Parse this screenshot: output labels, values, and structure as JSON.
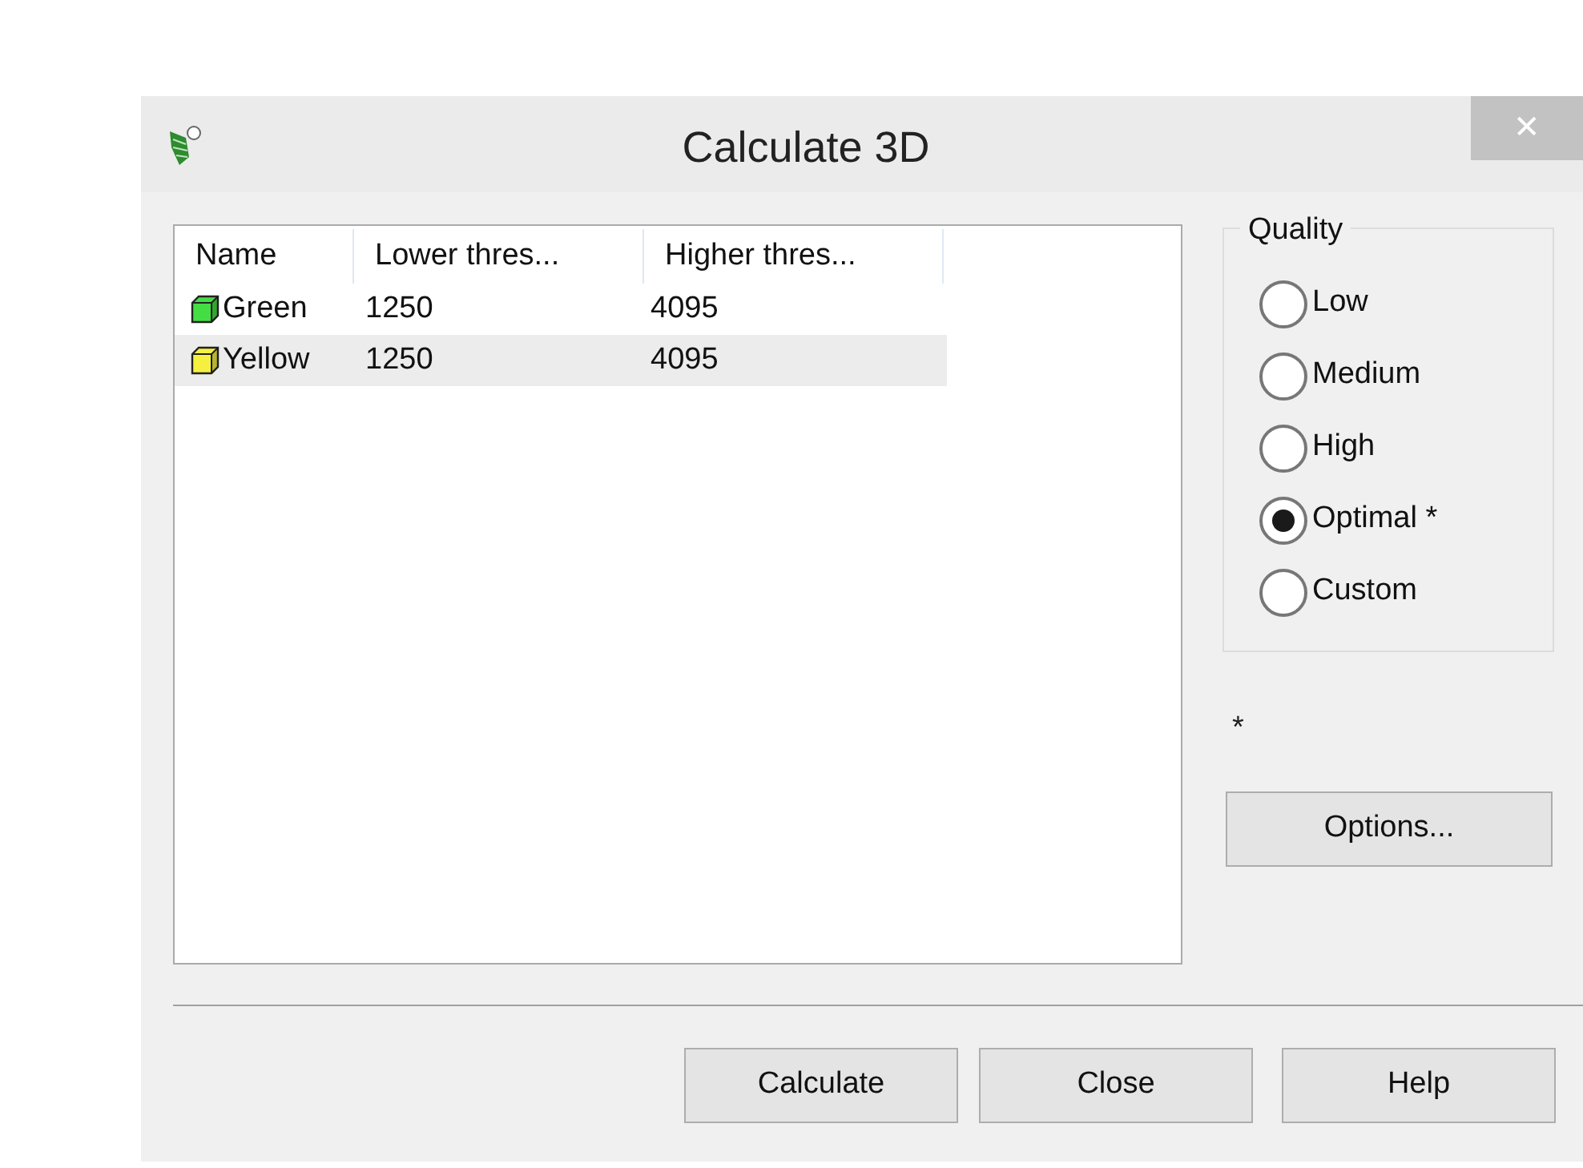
{
  "window": {
    "title": "Calculate 3D",
    "close": "✕"
  },
  "table": {
    "columns": [
      "Name",
      "Lower thres...",
      "Higher thres..."
    ],
    "rows": [
      {
        "name": "Green",
        "color": "#44dd44",
        "lower": "1250",
        "higher": "4095",
        "selected": false
      },
      {
        "name": "Yellow",
        "color": "#f5f040",
        "lower": "1250",
        "higher": "4095",
        "selected": true
      }
    ]
  },
  "quality": {
    "title": "Quality",
    "options": [
      {
        "label": "Low",
        "selected": false
      },
      {
        "label": "Medium",
        "selected": false
      },
      {
        "label": "High",
        "selected": false
      },
      {
        "label": "Optimal *",
        "selected": true
      },
      {
        "label": "Custom",
        "selected": false
      }
    ]
  },
  "note": "*",
  "options_button": "Options...",
  "buttons": [
    "Calculate",
    "Close",
    "Help"
  ]
}
